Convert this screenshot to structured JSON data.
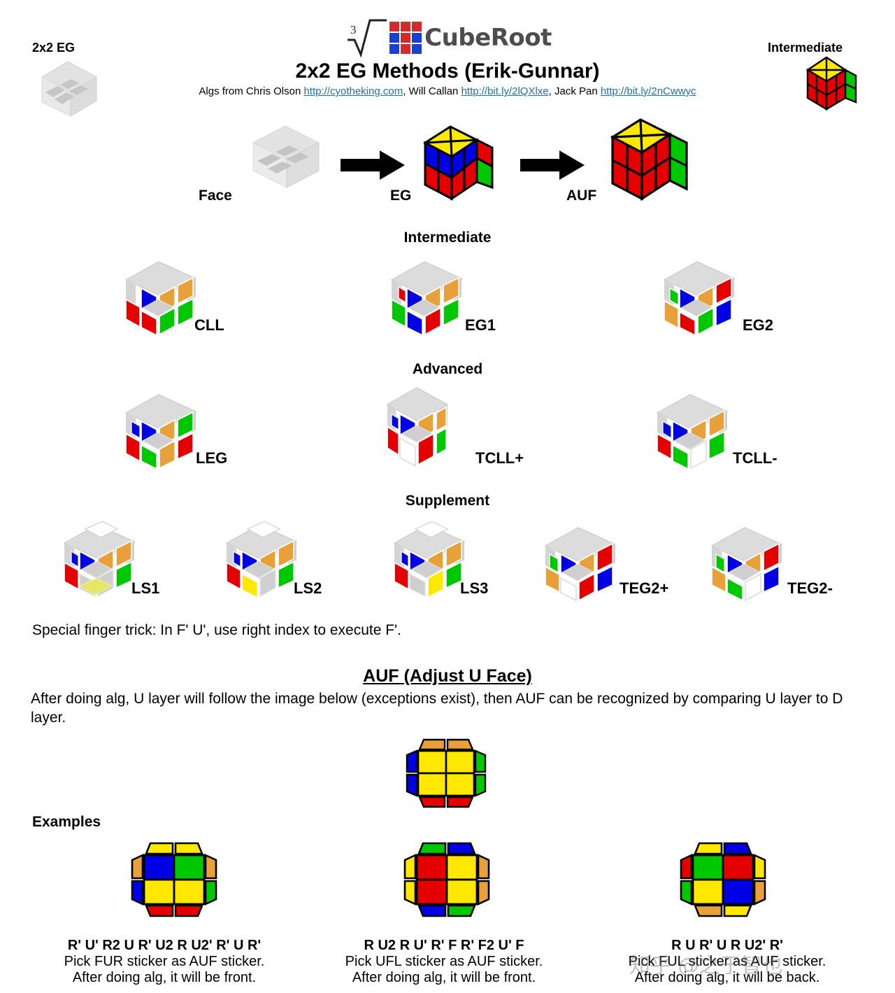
{
  "brand": {
    "root_index": "3",
    "name": "CubeRoot",
    "logo_colors": [
      "#d22b2b",
      "#d22b2b",
      "#d22b2b",
      "#1a3fd4",
      "#d22b2b",
      "#1a3fd4",
      "#1a3fd4",
      "#d22b2b",
      "#1a3fd4"
    ]
  },
  "header": {
    "title": "2x2 EG Methods (Erik-Gunnar)",
    "credits_prefix": "Algs from Chris Olson ",
    "credits": [
      {
        "name": "Chris Olson",
        "url": "http://cyotheking.com"
      },
      {
        "name": "Will Callan",
        "url": "http://bit.ly/2lQXlxe"
      },
      {
        "name": "Jack Pan",
        "url": "http://bit.ly/2nCwwyc"
      }
    ],
    "credits_parts": {
      "p1": "Algs from Chris Olson ",
      "u1": "http://cyotheking.com",
      "p2": ", Will Callan ",
      "u2": "http://bit.ly/2lQXlxe",
      "p3": ", Jack Pan ",
      "u3": "http://bit.ly/2nCwwyc"
    }
  },
  "corners": {
    "left_label": "2x2 EG",
    "right_label": "Intermediate"
  },
  "flow": {
    "steps": [
      "Face",
      "EG",
      "AUF"
    ]
  },
  "sections": [
    {
      "title": "Intermediate",
      "cases": [
        "CLL",
        "EG1",
        "EG2"
      ]
    },
    {
      "title": "Advanced",
      "cases": [
        "LEG",
        "TCLL+",
        "TCLL-"
      ]
    },
    {
      "title": "Supplement",
      "cases": [
        "LS1",
        "LS2",
        "LS3",
        "TEG2+",
        "TEG2-"
      ]
    }
  ],
  "case_labels": {
    "cll": "CLL",
    "eg1": "EG1",
    "eg2": "EG2",
    "leg": "LEG",
    "tcll_plus": "TCLL+",
    "tcll_minus": "TCLL-",
    "ls1": "LS1",
    "ls2": "LS2",
    "ls3": "LS3",
    "teg2_plus": "TEG2+",
    "teg2_minus": "TEG2-"
  },
  "finger_trick": "Special finger trick: In F' U', use right index to execute F'.",
  "auf": {
    "heading": "AUF (Adjust U Face)",
    "paragraph": "After doing alg, U layer will follow the image below (exceptions exist), then AUF can be recognized by comparing U layer to D layer."
  },
  "examples_label": "Examples",
  "examples": [
    {
      "alg": "R' U' R2 U R' U2 R U2' R' U R'",
      "line1": "Pick FUR sticker as AUF sticker.",
      "line2": "After doing alg, it will be front."
    },
    {
      "alg": "R U2 R U' R' F R' F2 U' F",
      "line1": "Pick UFL sticker as AUF sticker.",
      "line2": "After doing alg, it will be front."
    },
    {
      "alg": "R U R' U R U2' R'",
      "line1": "Pick FUL sticker as AUF sticker.",
      "line2": "After doing alg, it will be back."
    }
  ],
  "watermark": "知乎 @之于智也",
  "colors": {
    "yellow": "#ffe800",
    "red": "#e50000",
    "green": "#00c800",
    "blue": "#0000e5",
    "orange": "#e8a13a",
    "white": "#ffffff",
    "grey": "#d6d6d6",
    "grey_dark": "#b8b8b8",
    "link": "#1f6fb5"
  },
  "auf_diagram": {
    "center": [
      [
        "yellow",
        "yellow"
      ],
      [
        "yellow",
        "yellow"
      ]
    ],
    "top": [
      "orange",
      "orange"
    ],
    "bottom": [
      "red",
      "red"
    ],
    "left": [
      "blue",
      "blue"
    ],
    "right": [
      "green",
      "green"
    ]
  },
  "example_diagrams": [
    {
      "center": [
        [
          "blue",
          "green"
        ],
        [
          "yellow",
          "yellow"
        ]
      ],
      "top": [
        "yellow",
        "yellow"
      ],
      "bottom": [
        "red",
        "red"
      ],
      "left": [
        "orange",
        "blue"
      ],
      "right": [
        "orange",
        "green"
      ]
    },
    {
      "center": [
        [
          "red",
          "yellow"
        ],
        [
          "red",
          "yellow"
        ]
      ],
      "top": [
        "green",
        "blue"
      ],
      "bottom": [
        "blue",
        "green"
      ],
      "left": [
        "yellow",
        "yellow"
      ],
      "right": [
        "orange",
        "orange"
      ]
    },
    {
      "center": [
        [
          "green",
          "red"
        ],
        [
          "yellow",
          "blue"
        ]
      ],
      "top": [
        "yellow",
        "blue"
      ],
      "bottom": [
        "orange",
        "yellow"
      ],
      "left": [
        "red",
        "green"
      ],
      "right": [
        "yellow",
        "orange"
      ]
    }
  ],
  "flow_cubes": {
    "face": {
      "type": "grey"
    },
    "eg": {
      "top": [
        [
          "yellow",
          "yellow"
        ],
        [
          "yellow",
          "yellow"
        ]
      ],
      "front": [
        [
          "blue",
          "blue"
        ],
        [
          "red",
          "red"
        ]
      ],
      "right": [
        [
          "red",
          "red"
        ],
        [
          "green",
          "green"
        ]
      ]
    },
    "auf": {
      "top": [
        [
          "yellow",
          "yellow"
        ],
        [
          "yellow",
          "yellow"
        ]
      ],
      "front": [
        [
          "red",
          "red"
        ],
        [
          "red",
          "red"
        ]
      ],
      "right": [
        [
          "green",
          "green"
        ],
        [
          "green",
          "green"
        ]
      ]
    }
  },
  "corner_cube": {
    "top": [
      [
        "yellow",
        "yellow"
      ],
      [
        "yellow",
        "yellow"
      ]
    ],
    "front": [
      [
        "red",
        "red"
      ],
      [
        "red",
        "red"
      ]
    ],
    "right": [
      [
        "green",
        "green"
      ],
      [
        "green",
        "green"
      ]
    ]
  }
}
